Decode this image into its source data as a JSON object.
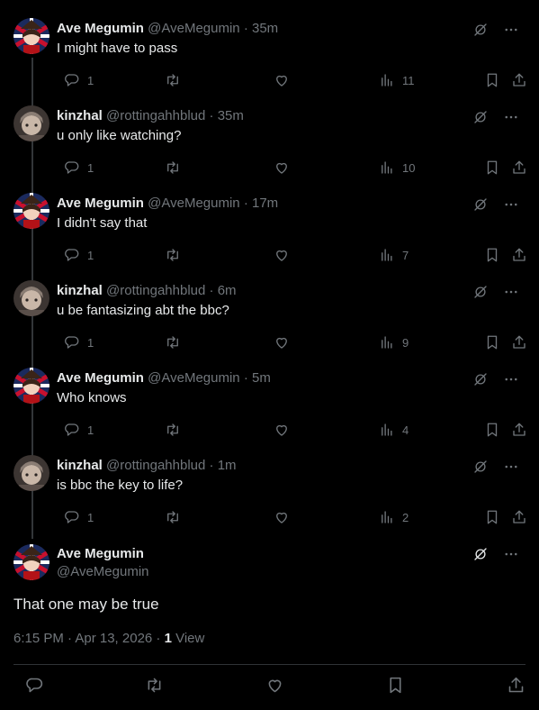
{
  "colors": {
    "background": "#000000",
    "text": "#e7e9ea",
    "muted": "#71767b",
    "rail": "#333639"
  },
  "replies": [
    {
      "name": "Ave Megumin",
      "handle": "@AveMegumin",
      "time": "35m",
      "text": "I might have to pass",
      "replies": "1",
      "views": "11",
      "avatar": "ave"
    },
    {
      "name": "kinzhal",
      "handle": "@rottingahhblud",
      "time": "35m",
      "text": "u only like watching?",
      "replies": "1",
      "views": "10",
      "avatar": "kin"
    },
    {
      "name": "Ave Megumin",
      "handle": "@AveMegumin",
      "time": "17m",
      "text": "I didn't say that",
      "replies": "1",
      "views": "7",
      "avatar": "ave"
    },
    {
      "name": "kinzhal",
      "handle": "@rottingahhblud",
      "time": "6m",
      "text": "u be fantasizing abt the bbc?",
      "replies": "1",
      "views": "9",
      "avatar": "kin"
    },
    {
      "name": "Ave Megumin",
      "handle": "@AveMegumin",
      "time": "5m",
      "text": "Who knows",
      "replies": "1",
      "views": "4",
      "avatar": "ave"
    },
    {
      "name": "kinzhal",
      "handle": "@rottingahhblud",
      "time": "1m",
      "text": "is bbc the key to life?",
      "replies": "1",
      "views": "2",
      "avatar": "kin"
    }
  ],
  "main": {
    "name": "Ave Megumin",
    "handle": "@AveMegumin",
    "text": "That one may be true",
    "timestamp": "6:15 PM · Apr 13, 2026 · ",
    "views_count": "1",
    "views_label": " View"
  },
  "separator": "·",
  "icons": [
    "grok-icon",
    "more-icon",
    "reply-icon",
    "retweet-icon",
    "like-icon",
    "views-icon",
    "bookmark-icon",
    "share-icon"
  ]
}
